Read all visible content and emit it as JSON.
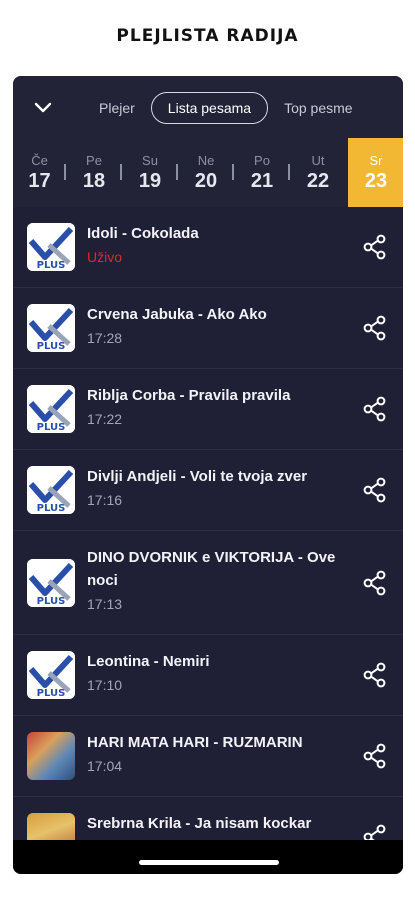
{
  "page_title": "PLEJLISTA RADIJA",
  "header": {
    "collapse_icon": "chevron-down-icon",
    "tabs": [
      {
        "label": "Plejer"
      },
      {
        "label": "Lista pesama",
        "active": true
      },
      {
        "label": "Top pesme"
      }
    ]
  },
  "days": [
    {
      "name": "Če",
      "num": "17"
    },
    {
      "name": "Pe",
      "num": "18"
    },
    {
      "name": "Su",
      "num": "19"
    },
    {
      "name": "Ne",
      "num": "20"
    },
    {
      "name": "Po",
      "num": "21"
    },
    {
      "name": "Ut",
      "num": "22"
    },
    {
      "name": "Sr",
      "num": "23",
      "active": true
    }
  ],
  "songs": [
    {
      "title": "Idoli - Cokolada",
      "time": "Uživo",
      "live": true,
      "logo": "PLUS"
    },
    {
      "title": "Crvena Jabuka - Ako Ako",
      "time": "17:28",
      "logo": "PLUS"
    },
    {
      "title": "Riblja Corba - Pravila pravila",
      "time": "17:22",
      "logo": "PLUS"
    },
    {
      "title": "Divlji Andjeli - Voli te tvoja zver",
      "time": "17:16",
      "logo": "PLUS"
    },
    {
      "title": "DINO DVORNIK e VIKTORIJA - Ove noci",
      "time": "17:13",
      "logo": "PLUS"
    },
    {
      "title": "Leontina - Nemiri",
      "time": "17:10",
      "logo": "PLUS"
    },
    {
      "title": "HARI MATA HARI - RUZMARIN",
      "time": "17:04"
    },
    {
      "title": "Srebrna Krila - Ja nisam kockar",
      "time": ""
    }
  ],
  "colors": {
    "background": "#1f2036",
    "accent": "#f2b733",
    "live": "#d92a31"
  }
}
